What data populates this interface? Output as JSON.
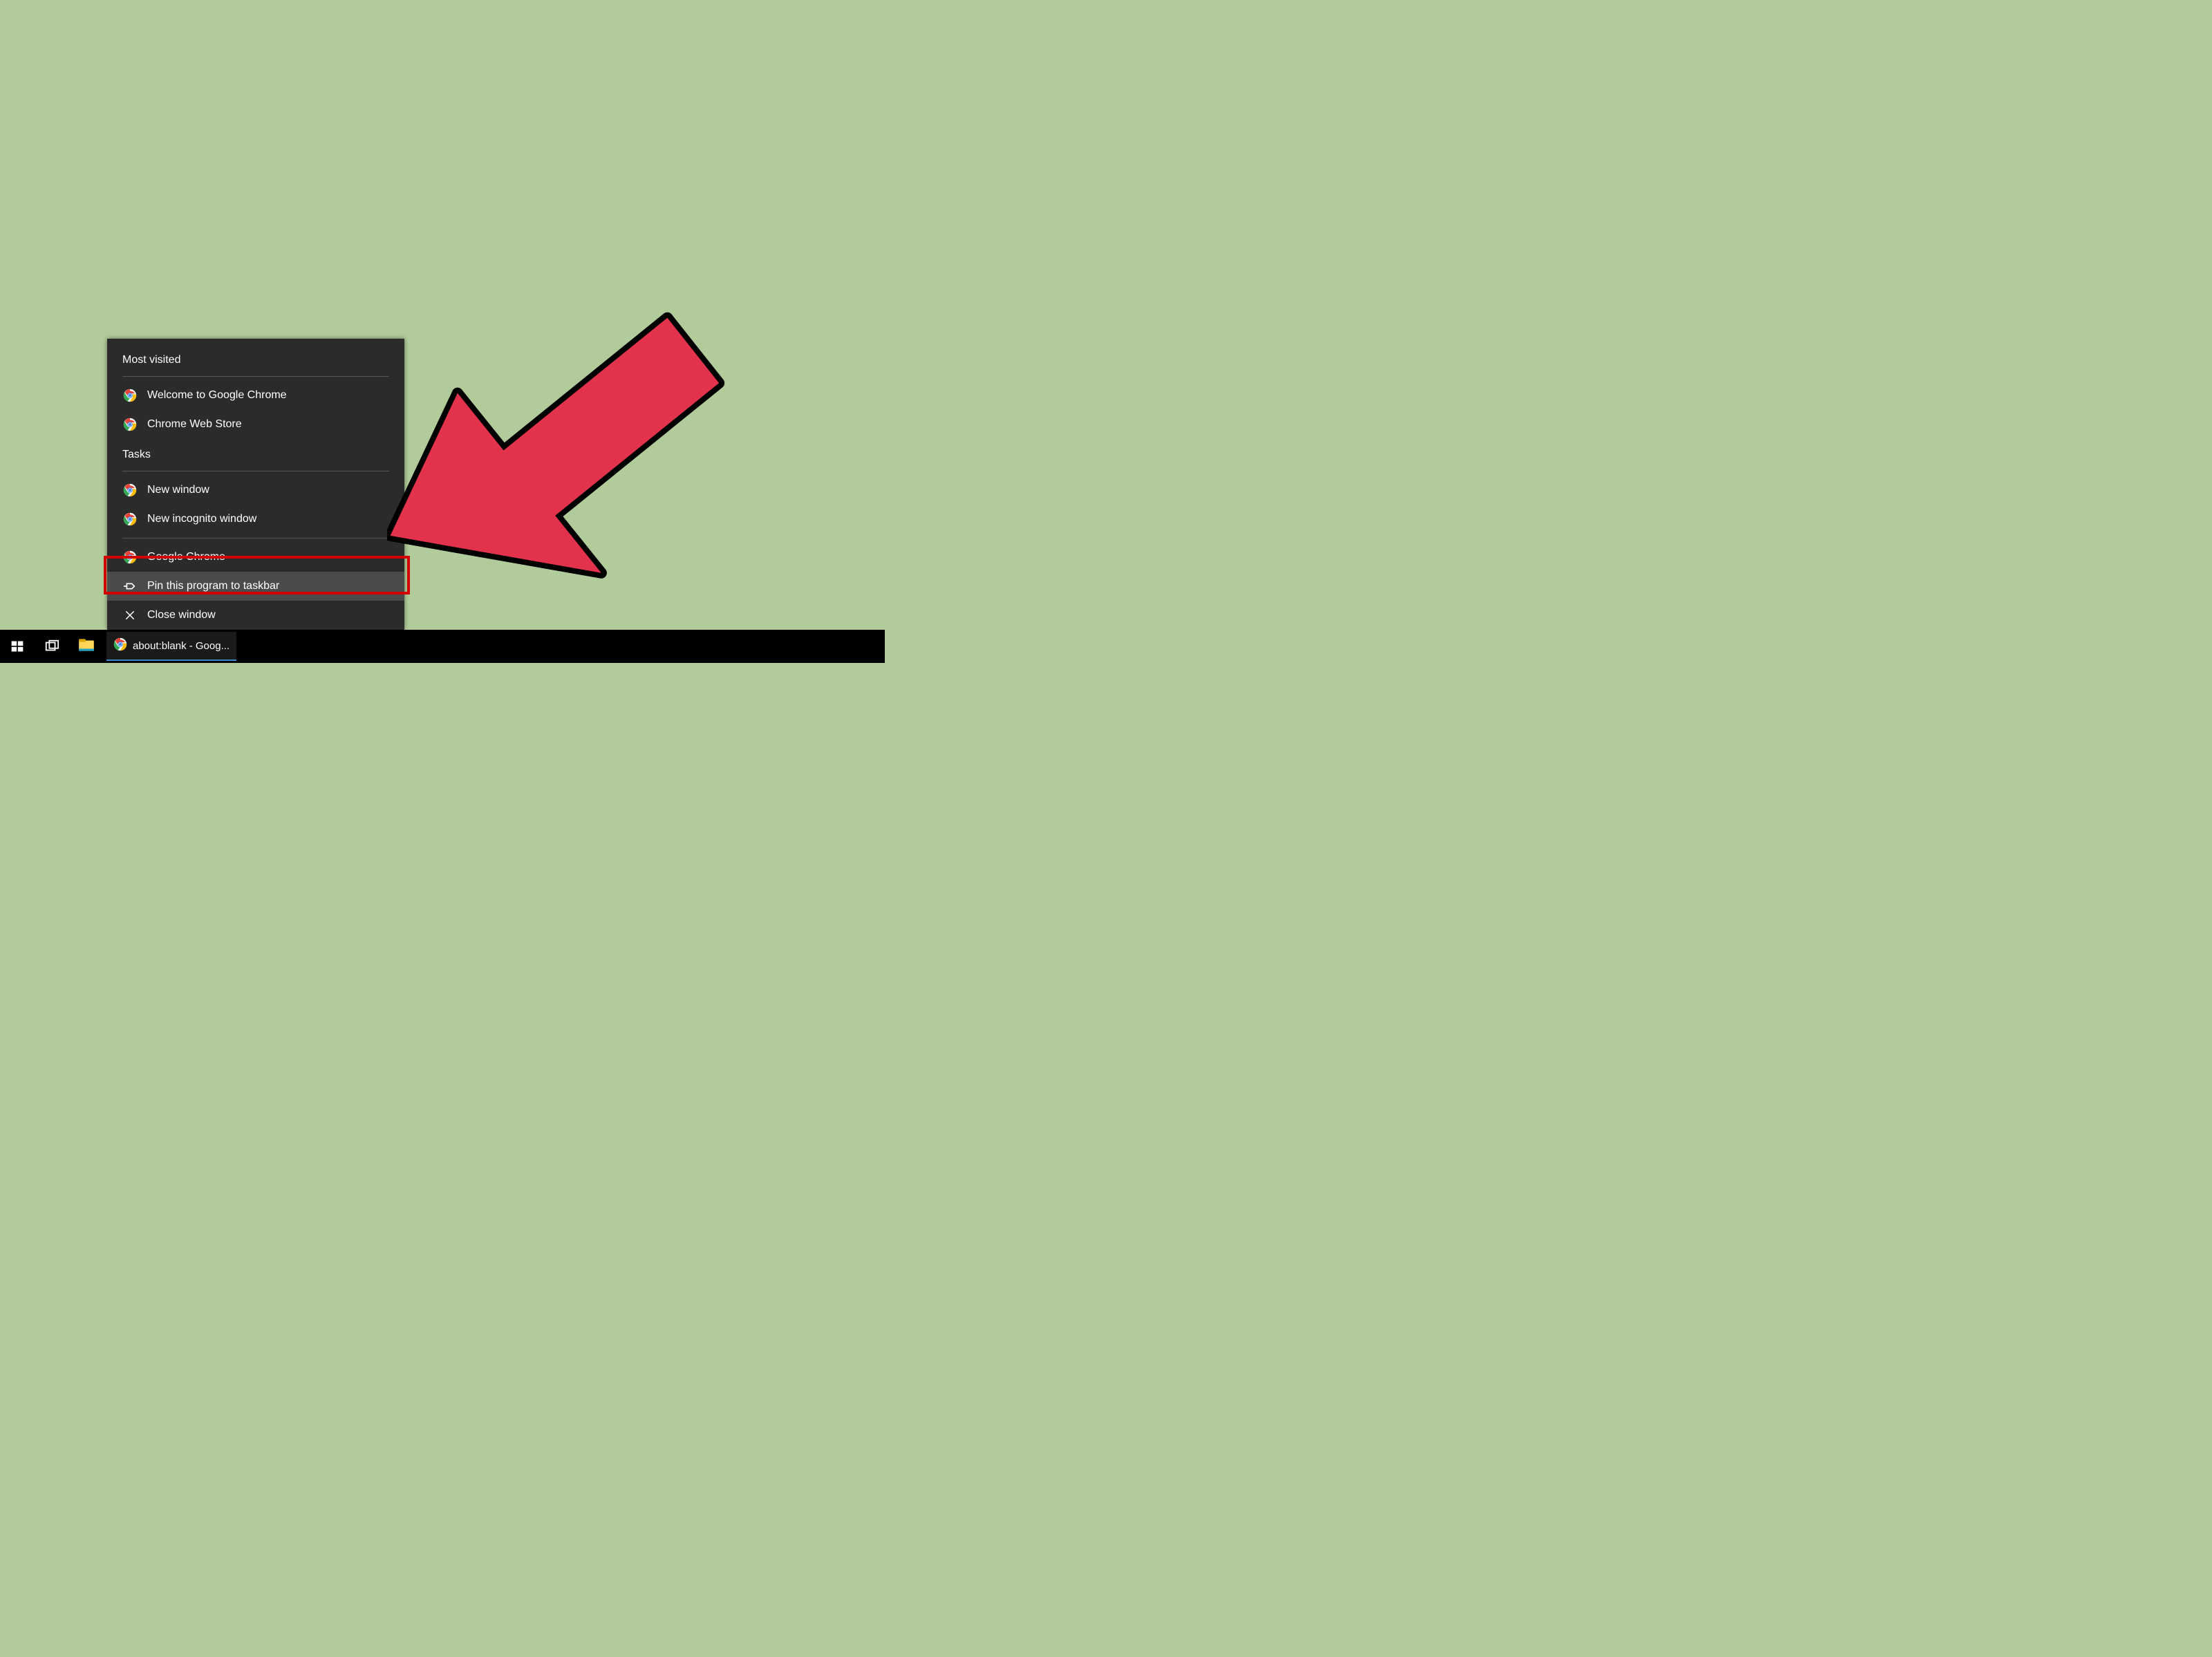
{
  "jumplist": {
    "heading_most_visited": "Most visited",
    "heading_tasks": "Tasks",
    "items_most_visited": [
      {
        "label": "Welcome to Google Chrome"
      },
      {
        "label": "Chrome Web Store"
      }
    ],
    "items_tasks": [
      {
        "label": "New window"
      },
      {
        "label": "New incognito window"
      },
      {
        "label": "Google Chrome"
      }
    ],
    "pin_label": "Pin this program to taskbar",
    "close_label": "Close window"
  },
  "taskbar": {
    "running_app_label": "about:blank - Goog..."
  }
}
